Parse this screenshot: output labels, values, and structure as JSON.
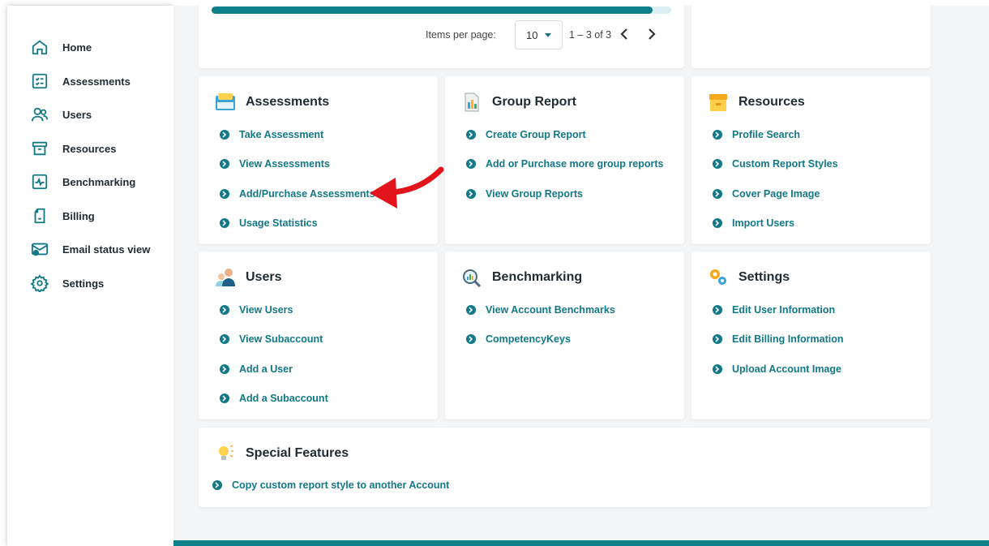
{
  "sidebar": {
    "items": [
      {
        "label": "Home",
        "icon": "home-icon"
      },
      {
        "label": "Assessments",
        "icon": "checklist-icon"
      },
      {
        "label": "Users",
        "icon": "users-icon"
      },
      {
        "label": "Resources",
        "icon": "archive-box-icon"
      },
      {
        "label": "Benchmarking",
        "icon": "pulse-chart-icon"
      },
      {
        "label": "Billing",
        "icon": "invoice-icon"
      },
      {
        "label": "Email status view",
        "icon": "email-check-icon"
      },
      {
        "label": "Settings",
        "icon": "gear-icon"
      }
    ]
  },
  "pagination": {
    "progress": 0.96,
    "items_per_page_label": "Items per page:",
    "items_per_page_value": "10",
    "range_text": "1 – 3 of 3"
  },
  "cards": {
    "assessments": {
      "title": "Assessments",
      "links": [
        "Take Assessment",
        "View Assessments",
        "Add/Purchase Assessments",
        "Usage Statistics"
      ]
    },
    "group_report": {
      "title": "Group Report",
      "links": [
        "Create Group Report",
        "Add or Purchase more group reports",
        "View Group Reports"
      ]
    },
    "resources": {
      "title": "Resources",
      "links": [
        "Profile Search",
        "Custom Report Styles",
        "Cover Page Image",
        "Import Users"
      ]
    },
    "users": {
      "title": "Users",
      "links": [
        "View Users",
        "View Subaccount",
        "Add a User",
        "Add a Subaccount"
      ]
    },
    "benchmarking": {
      "title": "Benchmarking",
      "links": [
        "View Account Benchmarks",
        "CompetencyKeys"
      ]
    },
    "settings": {
      "title": "Settings",
      "links": [
        "Edit User Information",
        "Edit Billing Information",
        "Upload Account Image"
      ]
    },
    "special_features": {
      "title": "Special Features",
      "links": [
        "Copy custom report style to another Account"
      ]
    }
  },
  "colors": {
    "accent": "#127886",
    "annotation_arrow": "#e3141b"
  }
}
